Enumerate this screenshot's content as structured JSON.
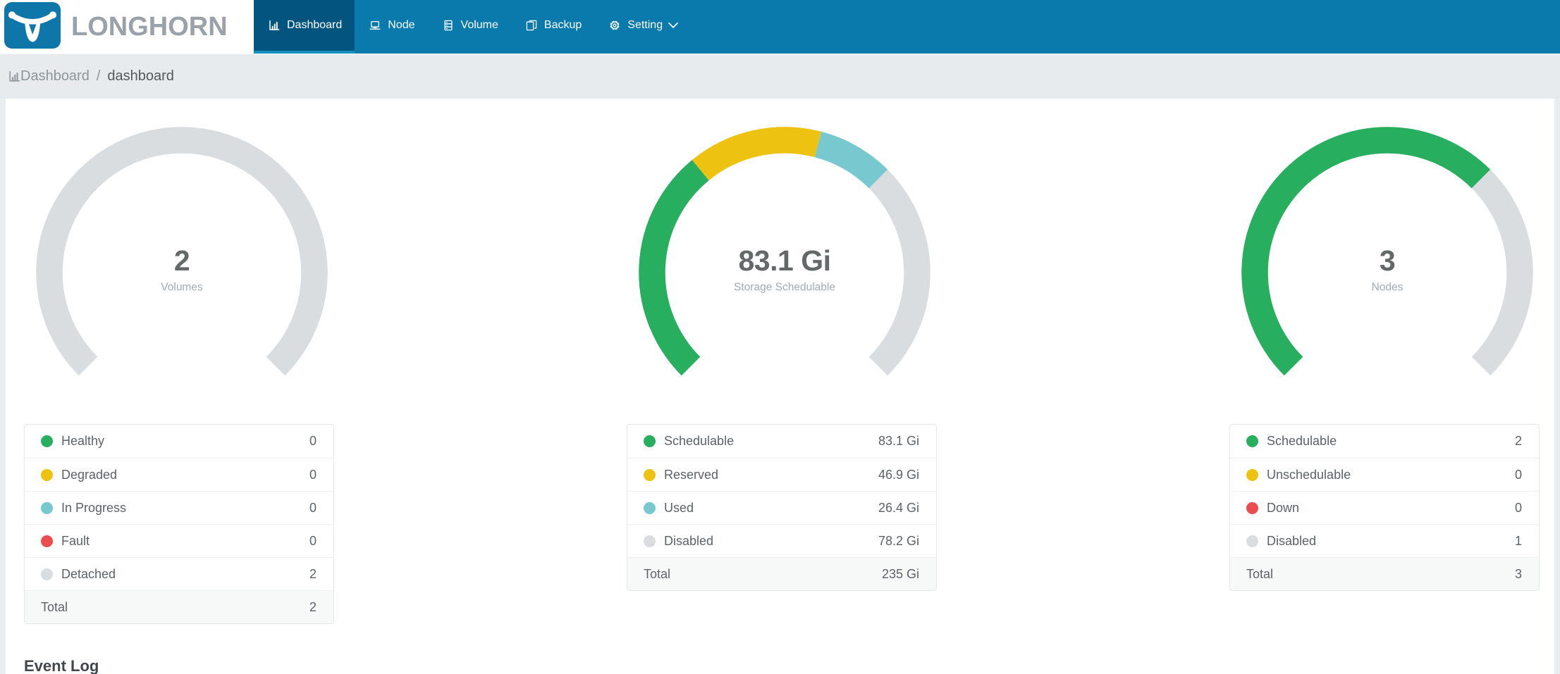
{
  "brand": {
    "name": "LONGHORN"
  },
  "nav": {
    "items": [
      {
        "label": "Dashboard",
        "icon": "bar-chart-icon",
        "active": true,
        "has_dropdown": false
      },
      {
        "label": "Node",
        "icon": "laptop-icon",
        "active": false,
        "has_dropdown": false
      },
      {
        "label": "Volume",
        "icon": "database-icon",
        "active": false,
        "has_dropdown": false
      },
      {
        "label": "Backup",
        "icon": "copy-icon",
        "active": false,
        "has_dropdown": false
      },
      {
        "label": "Setting",
        "icon": "gear-icon",
        "active": false,
        "has_dropdown": true
      }
    ]
  },
  "breadcrumb": {
    "icon": "bar-chart-icon",
    "root": "Dashboard",
    "separator": "/",
    "current": "dashboard"
  },
  "section_title": "Event Log",
  "colors": {
    "brand_blue": "#0e76a8",
    "navbar": "#0678a9",
    "navbar_active": "#03547e",
    "navbar_inkbar": "#1591c1",
    "healthy_green": "#27ae5e",
    "warning_yellow": "#eec211",
    "progress_cyan": "#78c9cf",
    "fault_red": "#ea4c50",
    "inactive_gray": "#d9dde0"
  },
  "chart_data": [
    {
      "type": "gauge",
      "name": "volumes",
      "center_value": "2",
      "center_label": "Volumes",
      "start_angle": 225,
      "sweep": 270,
      "segments": [
        {
          "label": "Healthy",
          "value": 0,
          "display": "0",
          "color": "#27ae5e"
        },
        {
          "label": "Degraded",
          "value": 0,
          "display": "0",
          "color": "#eec211"
        },
        {
          "label": "In Progress",
          "value": 0,
          "display": "0",
          "color": "#78c9cf"
        },
        {
          "label": "Fault",
          "value": 0,
          "display": "0",
          "color": "#ea4c50"
        },
        {
          "label": "Detached",
          "value": 2,
          "display": "2",
          "color": "#d9dde0"
        }
      ],
      "total": {
        "label": "Total",
        "display": "2"
      }
    },
    {
      "type": "gauge",
      "name": "storage",
      "center_value": "83.1 Gi",
      "center_label": "Storage Schedulable",
      "start_angle": 225,
      "sweep": 270,
      "segments": [
        {
          "label": "Schedulable",
          "value": 83.1,
          "display": "83.1 Gi",
          "color": "#27ae5e"
        },
        {
          "label": "Reserved",
          "value": 46.9,
          "display": "46.9 Gi",
          "color": "#eec211"
        },
        {
          "label": "Used",
          "value": 26.4,
          "display": "26.4 Gi",
          "color": "#78c9cf"
        },
        {
          "label": "Disabled",
          "value": 78.2,
          "display": "78.2 Gi",
          "color": "#d9dde0"
        }
      ],
      "total": {
        "label": "Total",
        "display": "235 Gi"
      }
    },
    {
      "type": "gauge",
      "name": "nodes",
      "center_value": "3",
      "center_label": "Nodes",
      "start_angle": 225,
      "sweep": 270,
      "segments": [
        {
          "label": "Schedulable",
          "value": 2,
          "display": "2",
          "color": "#27ae5e"
        },
        {
          "label": "Unschedulable",
          "value": 0,
          "display": "0",
          "color": "#eec211"
        },
        {
          "label": "Down",
          "value": 0,
          "display": "0",
          "color": "#ea4c50"
        },
        {
          "label": "Disabled",
          "value": 1,
          "display": "1",
          "color": "#d9dde0"
        }
      ],
      "total": {
        "label": "Total",
        "display": "3"
      }
    }
  ]
}
